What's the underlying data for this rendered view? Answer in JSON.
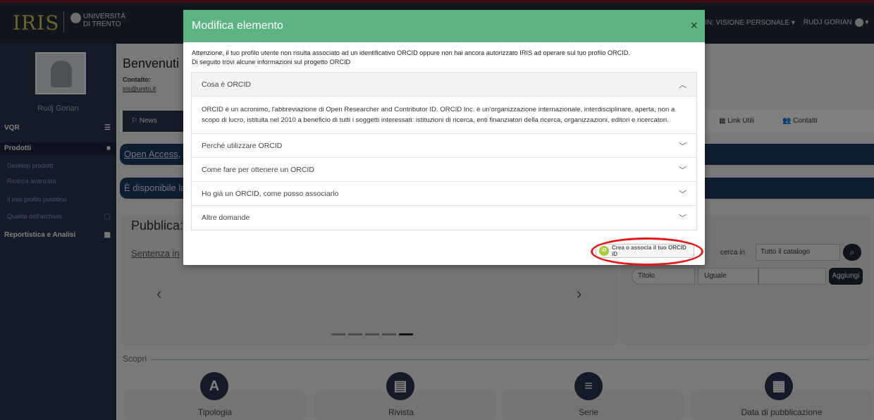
{
  "header": {
    "logo_text": "IRIS",
    "university": "UNIVERSITÀ DI TRENTO",
    "view_label": "IN: VISIONE PERSONALE",
    "user_label": "RUDJ GORIAN"
  },
  "sidebar": {
    "username": "Rudj Gorian",
    "items": [
      {
        "label": "VQR"
      },
      {
        "label": "Prodotti"
      },
      {
        "label": "Desktop prodotti"
      },
      {
        "label": "Ricerca avanzata"
      },
      {
        "label": "Il mio profilo pubblico"
      },
      {
        "label": "Qualità dell'archivio"
      },
      {
        "label": "Reportistica e Analisi"
      }
    ]
  },
  "main": {
    "welcome": "Benvenuti",
    "contact_label": "Contatto:",
    "contact_email": "iris@unitn.it",
    "news_label": "News",
    "links_label": "Link Utili",
    "contacts_label": "Contatti",
    "banner1": "Open Access,",
    "banner2": "È disponibile la",
    "pub_title": "Pubblica:",
    "pub_link": "Sentenza in",
    "scopri_label": "Scopri",
    "cards": [
      {
        "label": "Tipologia",
        "icon": "A"
      },
      {
        "label": "Rivista",
        "icon": "book-icon"
      },
      {
        "label": "Serie",
        "icon": "document-icon"
      },
      {
        "label": "Data di pubblicazione",
        "icon": "calendar-icon"
      }
    ]
  },
  "search": {
    "cerca_in": "cerca in",
    "catalog_option": "Tutto il catalogo",
    "field_option": "Titolo",
    "match_option": "Uguale",
    "add_label": "Aggiungi"
  },
  "modal": {
    "title": "Modifica elemento",
    "close": "×",
    "warning_line1": "Attenzione, il tuo profilo utente non risulta associato ad un identificativo ORCID oppure non hai ancora autorizzato IRIS ad operare sul tuo profilo ORCID.",
    "warning_line2": "Di seguito trovi alcune informazioni sul progetto ORCID",
    "accordion": [
      {
        "title": "Cosa è ORCID",
        "expanded": true,
        "body": "ORCID è un acronimo, l'abbreviazione di Open Researcher and Contributor ID. ORCID Inc. è un'organizzazione internazionale, interdisciplinare, aperta, non a scopo di lucro, istituita nel 2010 a beneficio di tutti i soggetti interessati: istituzioni di ricerca, enti finanziatori della ricerca, organizzazioni, editori e ricercatori."
      },
      {
        "title": "Perché utilizzare ORCID",
        "expanded": false
      },
      {
        "title": "Come fare per ottenere un ORCID",
        "expanded": false
      },
      {
        "title": "Ho già un ORCID, come posso associarlo",
        "expanded": false
      },
      {
        "title": "Altre domande",
        "expanded": false
      }
    ],
    "orcid_button": "Crea o associa il tuo ORCID iD",
    "orcid_logo": "iD"
  },
  "colors": {
    "modal_header": "#5db382",
    "highlight": "#e01a1a",
    "sidebar": "#2a3550"
  }
}
